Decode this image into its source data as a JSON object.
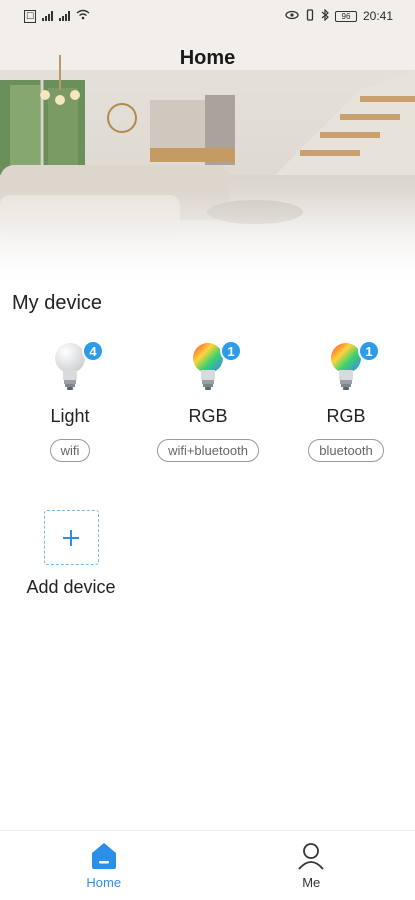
{
  "status_bar": {
    "time": "20:41",
    "battery": "96"
  },
  "header": {
    "title": "Home"
  },
  "section": {
    "title": "My device"
  },
  "devices": [
    {
      "name": "Light",
      "badge": "4",
      "connection": "wifi",
      "icon": "white-bulb-icon"
    },
    {
      "name": "RGB",
      "badge": "1",
      "connection": "wifi+bluetooth",
      "icon": "rgb-bulb-icon"
    },
    {
      "name": "RGB",
      "badge": "1",
      "connection": "bluetooth",
      "icon": "rgb-bulb-icon"
    }
  ],
  "add_device": {
    "label": "Add device"
  },
  "nav": {
    "home_label": "Home",
    "me_label": "Me"
  },
  "colors": {
    "accent": "#2b8ee8",
    "badge": "#2b9bea"
  }
}
